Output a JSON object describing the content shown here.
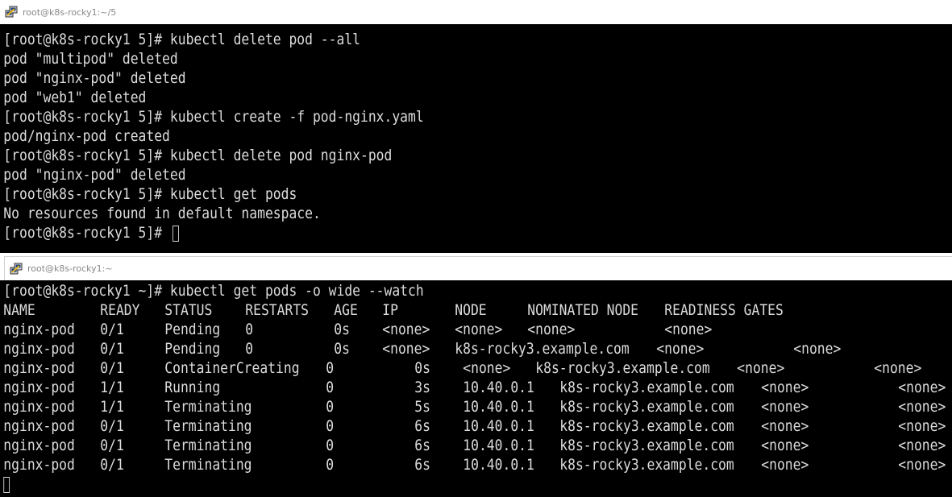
{
  "windows": [
    {
      "title": "root@k8s-rocky1:~/5",
      "lines": [
        "[root@k8s-rocky1 5]# kubectl delete pod --all",
        "pod \"multipod\" deleted",
        "pod \"nginx-pod\" deleted",
        "pod \"web1\" deleted",
        "[root@k8s-rocky1 5]# kubectl create -f pod-nginx.yaml",
        "pod/nginx-pod created",
        "[root@k8s-rocky1 5]# kubectl delete pod nginx-pod",
        "pod \"nginx-pod\" deleted",
        "[root@k8s-rocky1 5]# kubectl get pods",
        "No resources found in default namespace."
      ],
      "prompt": "[root@k8s-rocky1 5]# "
    },
    {
      "title": "root@k8s-rocky1:~",
      "command": "[root@k8s-rocky1 ~]# kubectl get pods -o wide --watch",
      "columns": [
        "NAME",
        "READY",
        "STATUS",
        "RESTARTS",
        "AGE",
        "IP",
        "NODE",
        "NOMINATED NODE",
        "READINESS GATES"
      ],
      "rows": [
        [
          "nginx-pod",
          "0/1",
          "Pending",
          "0",
          "0s",
          "<none>",
          "<none>",
          "<none>",
          "<none>"
        ],
        [
          "nginx-pod",
          "0/1",
          "Pending",
          "0",
          "0s",
          "<none>",
          "k8s-rocky3.example.com",
          "<none>",
          "<none>"
        ],
        [
          "nginx-pod",
          "0/1",
          "ContainerCreating",
          "0",
          "0s",
          "<none>",
          "k8s-rocky3.example.com",
          "<none>",
          "<none>"
        ],
        [
          "nginx-pod",
          "1/1",
          "Running",
          "0",
          "3s",
          "10.40.0.1",
          "k8s-rocky3.example.com",
          "<none>",
          "<none>"
        ],
        [
          "nginx-pod",
          "1/1",
          "Terminating",
          "0",
          "5s",
          "10.40.0.1",
          "k8s-rocky3.example.com",
          "<none>",
          "<none>"
        ],
        [
          "nginx-pod",
          "0/1",
          "Terminating",
          "0",
          "6s",
          "10.40.0.1",
          "k8s-rocky3.example.com",
          "<none>",
          "<none>"
        ],
        [
          "nginx-pod",
          "0/1",
          "Terminating",
          "0",
          "6s",
          "10.40.0.1",
          "k8s-rocky3.example.com",
          "<none>",
          "<none>"
        ],
        [
          "nginx-pod",
          "0/1",
          "Terminating",
          "0",
          "6s",
          "10.40.0.1",
          "k8s-rocky3.example.com",
          "<none>",
          "<none>"
        ]
      ]
    }
  ],
  "icons": {
    "app": "putty-icon",
    "cursor": "terminal-cursor"
  },
  "colors": {
    "terminal_bg": "#000000",
    "terminal_fg": "#dcdcdc",
    "title_text": "#888888"
  }
}
